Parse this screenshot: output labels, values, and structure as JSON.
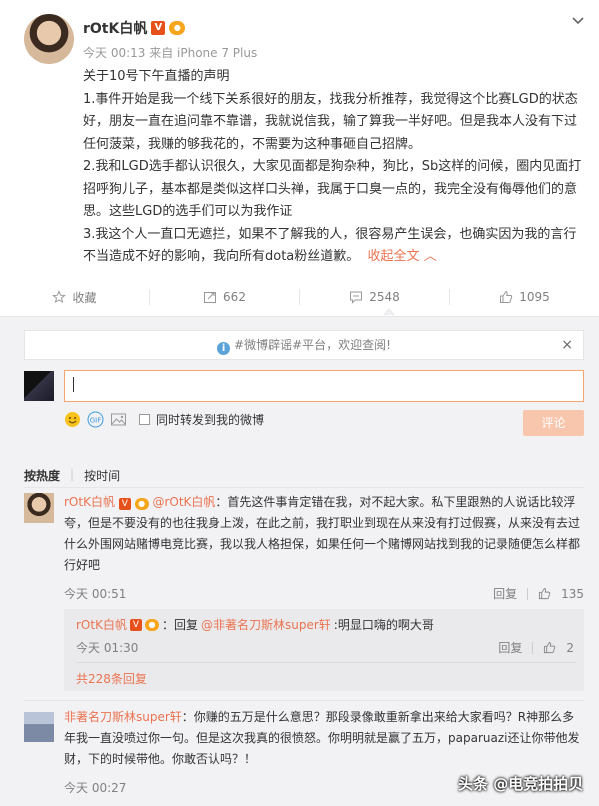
{
  "post": {
    "author": "rOtK白帆",
    "vip_badge": "V",
    "level_badge": "●",
    "meta": "今天 00:13 来自 iPhone 7 Plus",
    "paragraphs": [
      "关于10号下午直播的声明",
      "1.事件开始是我一个线下关系很好的朋友，找我分析推荐，我觉得这个比赛LGD的状态好，朋友一直在追问靠不靠谱，我就说信我，输了算我一半好吧。但是我本人没有下过任何菠菜，我赚的够我花的，不需要为这种事砸自己招牌。",
      "2.我和LGD选手都认识很久，大家见面都是狗杂种，狗比，Sb这样的问候，圈内见面打招呼狗儿子，基本都是类似这样口头禅，我属于口臭一点的，我完全没有侮辱他们的意思。这些LGD的选手们可以为我作证",
      "3.我这个人一直口无遮拦，如果不了解我的人，很容易产生误会，也确实因为我的言行不当造成不好的影响，我向所有dota粉丝道歉。"
    ],
    "collapse_label": "收起全文",
    "actions": {
      "favorite": "收藏",
      "repost": "662",
      "comment": "2548",
      "like": "1095"
    }
  },
  "comments_panel": {
    "notice": "#微博辟谣#平台，欢迎查阅!",
    "notice_close": "×",
    "input_value": "",
    "repost_checkbox_label": "同时转发到我的微博",
    "submit_label": "评论",
    "sort_hot": "按热度",
    "sort_time": "按时间",
    "comments": [
      {
        "author": "rOtK白帆",
        "mention": "@rOtK白帆",
        "text": "：首先这件事肯定错在我，对不起大家。私下里跟熟的人说话比较浮夸，但是不要没有的也往我身上泼，在此之前，我打职业到现在从来没有打过假赛，从来没有去过什么外围网站赌博电竞比赛，我以我人格担保，如果任何一个赌博网站找到我的记录随便怎么样都行好吧",
        "time": "今天 00:51",
        "reply_label": "回复",
        "likes": "135",
        "sub_reply": {
          "author": "rOtK白帆",
          "prefix": "：回复",
          "target": "@非著名刀斯林super轩",
          "text": ":明显口嗨的啊大哥",
          "time": "今天 01:30",
          "reply_label": "回复",
          "likes": "2"
        },
        "more_replies": "共228条回复"
      },
      {
        "author": "非著名刀斯林super轩",
        "text": "：你赚的五万是什么意思？那段录像敢重新拿出来给大家看吗？R神那么多年我一直没喷过你一句。但是这次我真的很愤怒。你明明就是赢了五万，paparuazi还让你带他发财，下的时候带他。你敢否认吗？！",
        "time": "今天 00:27"
      }
    ]
  },
  "watermark": "头条 @电竞拍拍贝",
  "colors": {
    "accent": "#eb7350",
    "vip": "#e6511b",
    "panel_bg": "#f2f2f5"
  }
}
